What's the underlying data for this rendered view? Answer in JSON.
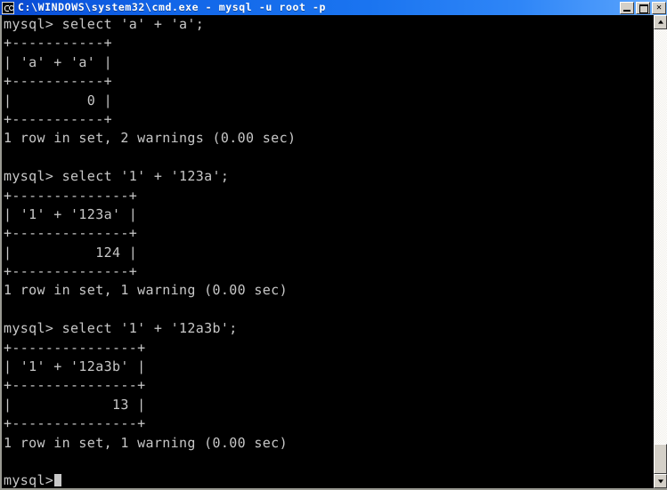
{
  "window": {
    "title": "C:\\WINDOWS\\system32\\cmd.exe - mysql -u root -p",
    "icon": "cmd-console-icon",
    "buttons": {
      "minimize": "minimize",
      "maximize": "maximize",
      "close": "✕"
    }
  },
  "scrollbar": {
    "up_arrow": "scroll-up",
    "down_arrow": "scroll-down",
    "thumb": "scroll-thumb"
  },
  "console": {
    "foreground_color": "#c8c8c8",
    "background_color": "#000000",
    "prompt": "mysql>",
    "cursor_visible": true,
    "lines": [
      "mysql> select 'a' + 'a';",
      "+-----------+",
      "| 'a' + 'a' |",
      "+-----------+",
      "|         0 |",
      "+-----------+",
      "1 row in set, 2 warnings (0.00 sec)",
      "",
      "mysql> select '1' + '123a';",
      "+--------------+",
      "| '1' + '123a' |",
      "+--------------+",
      "|          124 |",
      "+--------------+",
      "1 row in set, 1 warning (0.00 sec)",
      "",
      "mysql> select '1' + '12a3b';",
      "+---------------+",
      "| '1' + '12a3b' |",
      "+---------------+",
      "|            13 |",
      "+---------------+",
      "1 row in set, 1 warning (0.00 sec)",
      "",
      "mysql>"
    ],
    "queries": [
      {
        "statement": "select 'a' + 'a';",
        "column_header": "'a' + 'a'",
        "value": "0",
        "status": "1 row in set, 2 warnings (0.00 sec)",
        "rows": 1,
        "warnings": 2,
        "duration": "0.00 sec"
      },
      {
        "statement": "select '1' + '123a';",
        "column_header": "'1' + '123a'",
        "value": "124",
        "status": "1 row in set, 1 warning (0.00 sec)",
        "rows": 1,
        "warnings": 1,
        "duration": "0.00 sec"
      },
      {
        "statement": "select '1' + '12a3b';",
        "column_header": "'1' + '12a3b'",
        "value": "13",
        "status": "1 row in set, 1 warning (0.00 sec)",
        "rows": 1,
        "warnings": 1,
        "duration": "0.00 sec"
      }
    ]
  }
}
